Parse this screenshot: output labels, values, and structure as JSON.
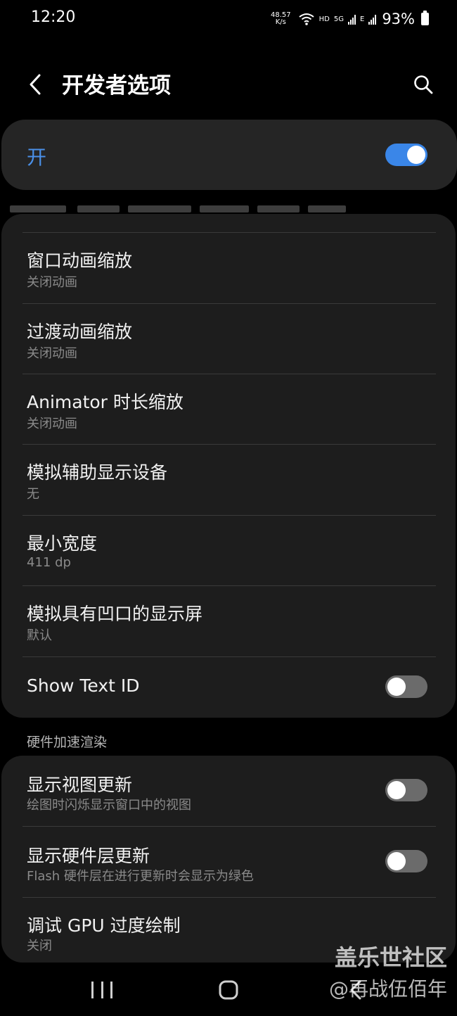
{
  "status_bar": {
    "time": "12:20",
    "net_speed_value": "48.57",
    "net_speed_unit": "K/s",
    "hd_label": "HD",
    "sim1_label": "5G",
    "sim2_label": "E",
    "battery": "93%"
  },
  "header": {
    "title": "开发者选项",
    "back_icon": "chevron-left-icon",
    "search_icon": "search-icon"
  },
  "master": {
    "label": "开",
    "toggle_on": true,
    "accent_color": "#3a86e8"
  },
  "items": [
    {
      "title": "窗口动画缩放",
      "subtitle": "关闭动画"
    },
    {
      "title": "过渡动画缩放",
      "subtitle": "关闭动画"
    },
    {
      "title": "Animator 时长缩放",
      "subtitle": "关闭动画"
    },
    {
      "title": "模拟辅助显示设备",
      "subtitle": "无"
    },
    {
      "title": "最小宽度",
      "subtitle": "411 dp"
    },
    {
      "title": "模拟具有凹口的显示屏",
      "subtitle": "默认"
    },
    {
      "title": "Show Text ID",
      "toggle_on": false
    }
  ],
  "section": {
    "title": "硬件加速渲染"
  },
  "hw_items": [
    {
      "title": "显示视图更新",
      "subtitle": "绘图时闪烁显示窗口中的视图",
      "toggle_on": false
    },
    {
      "title": "显示硬件层更新",
      "subtitle": "Flash 硬件层在进行更新时会显示为绿色",
      "toggle_on": false
    },
    {
      "title": "调试 GPU 过度绘制",
      "subtitle": "关闭"
    }
  ],
  "watermark": {
    "line1": "盖乐世社区",
    "line2": "@再战伍佰年"
  },
  "nav": {
    "recents_icon": "recents-icon",
    "home_icon": "home-icon",
    "back_icon": "back-icon"
  }
}
